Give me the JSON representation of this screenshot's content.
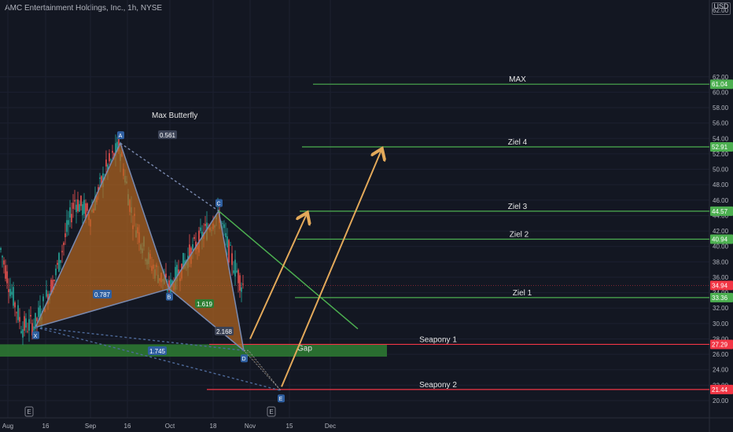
{
  "header": {
    "title": "AMC Entertainment Holdings, Inc., 1h, NYSE",
    "currency": "USD"
  },
  "colors": {
    "background": "#131722",
    "pattern_fill": "#b5661f",
    "pattern_edge": "#7a8ab0",
    "target_green": "#4caf50",
    "support_red": "#f23645",
    "arrow_orange": "#e3a95a",
    "gap_zone": "#2e7d32"
  },
  "chart_data": {
    "type": "candlestick-annotated",
    "y_axis": {
      "min": 19,
      "max": 63,
      "ticks": [
        20,
        22,
        24,
        26,
        28,
        30,
        32,
        34,
        36,
        38,
        40,
        42,
        44,
        46,
        48,
        50,
        52,
        54,
        56,
        58,
        60,
        62
      ],
      "top_label": "62.00"
    },
    "x_axis": {
      "ticks": [
        "Aug",
        "16",
        "Sep",
        "16",
        "Oct",
        "18",
        "Nov",
        "15",
        "Dec"
      ]
    },
    "current_price": "34.94",
    "levels": [
      {
        "name": "MAX",
        "value": 61.04,
        "label": "61.04",
        "color": "green"
      },
      {
        "name": "Ziel 4",
        "value": 52.91,
        "label": "52.91",
        "color": "green"
      },
      {
        "name": "Ziel 3",
        "value": 44.57,
        "label": "44.57",
        "color": "green"
      },
      {
        "name": "Ziel 2",
        "value": 40.94,
        "label": "40.94",
        "color": "green"
      },
      {
        "name": "Ziel 1",
        "value": 33.36,
        "label": "33.36",
        "color": "green"
      },
      {
        "name": "Seapony 1",
        "value": 27.29,
        "label": "27.29",
        "color": "red"
      },
      {
        "name": "Seapony 2",
        "value": 21.44,
        "label": "21.44",
        "color": "red"
      }
    ],
    "gap_zone": {
      "label": "Gap",
      "top": 27.3,
      "bottom": 25.7
    },
    "pattern": {
      "name": "Max Butterfly",
      "points": [
        {
          "name": "X",
          "price": 29.5
        },
        {
          "name": "A",
          "price": 53.4
        },
        {
          "name": "B",
          "price": 34.5
        },
        {
          "name": "C",
          "price": 44.6
        },
        {
          "name": "D",
          "price": 26.5
        },
        {
          "name": "E",
          "price": 21.3
        }
      ],
      "ratios": [
        "0.561",
        "1.619",
        "2.168",
        "0.787",
        "1.745"
      ]
    },
    "event_markers": [
      "E",
      "E"
    ]
  }
}
